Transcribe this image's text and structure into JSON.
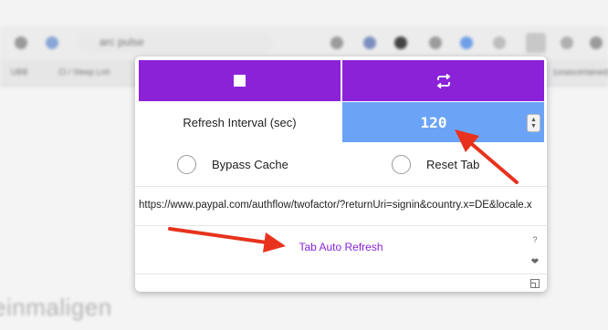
{
  "background": {
    "address_text": "arc pulse",
    "bookmarks": [
      "UBB",
      "Cl / Sleep Lnh",
      "(unascertained)"
    ],
    "page_heading": "einmaligen"
  },
  "popup": {
    "stop_icon": "stop-icon",
    "refresh_icon": "repeat-icon",
    "interval_label": "Refresh Interval (sec)",
    "interval_value": "120",
    "options": {
      "bypass_cache": "Bypass Cache",
      "reset_tab": "Reset Tab"
    },
    "url": "https://www.paypal.com/authflow/twofactor/?returnUri=signin&country.x=DE&locale.x",
    "brand_link": "Tab Auto Refresh",
    "side_icons": {
      "help": "?",
      "heart": "❤",
      "resize": "resize-icon"
    }
  },
  "colors": {
    "accent_purple": "#8b22d8",
    "interval_blue": "#6ba4f7",
    "arrow_red": "#e8321d"
  }
}
